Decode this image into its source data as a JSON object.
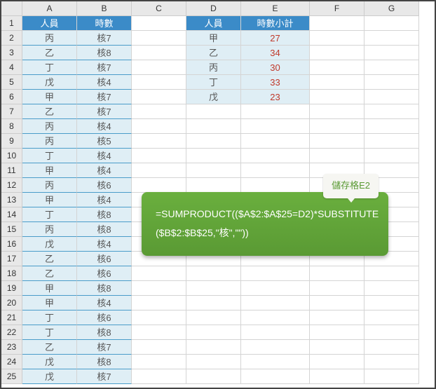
{
  "columns": [
    "A",
    "B",
    "C",
    "D",
    "E",
    "F",
    "G"
  ],
  "headerAB": {
    "person": "人員",
    "hours": "時數"
  },
  "headerDE": {
    "person": "人員",
    "subtotal": "時數小計"
  },
  "rowsAB": [
    [
      "丙",
      "核7"
    ],
    [
      "乙",
      "核8"
    ],
    [
      "丁",
      "核7"
    ],
    [
      "戊",
      "核4"
    ],
    [
      "甲",
      "核7"
    ],
    [
      "乙",
      "核7"
    ],
    [
      "丙",
      "核4"
    ],
    [
      "丙",
      "核5"
    ],
    [
      "丁",
      "核4"
    ],
    [
      "甲",
      "核4"
    ],
    [
      "丙",
      "核6"
    ],
    [
      "甲",
      "核4"
    ],
    [
      "丁",
      "核8"
    ],
    [
      "丙",
      "核8"
    ],
    [
      "戊",
      "核4"
    ],
    [
      "乙",
      "核6"
    ],
    [
      "乙",
      "核6"
    ],
    [
      "甲",
      "核8"
    ],
    [
      "甲",
      "核4"
    ],
    [
      "丁",
      "核6"
    ],
    [
      "丁",
      "核8"
    ],
    [
      "乙",
      "核7"
    ],
    [
      "戊",
      "核8"
    ],
    [
      "戊",
      "核7"
    ]
  ],
  "rowsDE": [
    [
      "甲",
      "27"
    ],
    [
      "乙",
      "34"
    ],
    [
      "丙",
      "30"
    ],
    [
      "丁",
      "33"
    ],
    [
      "戊",
      "23"
    ]
  ],
  "callout": {
    "label": "儲存格E2",
    "formula_line1": "=SUMPRODUCT(($A$2:$A$25=D2)*SUBSTITUTE",
    "formula_line2": "($B$2:$B$25,\"核\",\"\"))"
  },
  "chart_data": {
    "type": "table",
    "main": {
      "columns": [
        "人員",
        "時數"
      ],
      "rows": [
        [
          "丙",
          "核7"
        ],
        [
          "乙",
          "核8"
        ],
        [
          "丁",
          "核7"
        ],
        [
          "戊",
          "核4"
        ],
        [
          "甲",
          "核7"
        ],
        [
          "乙",
          "核7"
        ],
        [
          "丙",
          "核4"
        ],
        [
          "丙",
          "核5"
        ],
        [
          "丁",
          "核4"
        ],
        [
          "甲",
          "核4"
        ],
        [
          "丙",
          "核6"
        ],
        [
          "甲",
          "核4"
        ],
        [
          "丁",
          "核8"
        ],
        [
          "丙",
          "核8"
        ],
        [
          "戊",
          "核4"
        ],
        [
          "乙",
          "核6"
        ],
        [
          "乙",
          "核6"
        ],
        [
          "甲",
          "核8"
        ],
        [
          "甲",
          "核4"
        ],
        [
          "丁",
          "核6"
        ],
        [
          "丁",
          "核8"
        ],
        [
          "乙",
          "核7"
        ],
        [
          "戊",
          "核8"
        ],
        [
          "戊",
          "核7"
        ]
      ]
    },
    "summary": {
      "columns": [
        "人員",
        "時數小計"
      ],
      "rows": [
        [
          "甲",
          27
        ],
        [
          "乙",
          34
        ],
        [
          "丙",
          30
        ],
        [
          "丁",
          33
        ],
        [
          "戊",
          23
        ]
      ]
    },
    "formula": "=SUMPRODUCT(($A$2:$A$25=D2)*SUBSTITUTE($B$2:$B$25,\"核\",\"\"))"
  }
}
